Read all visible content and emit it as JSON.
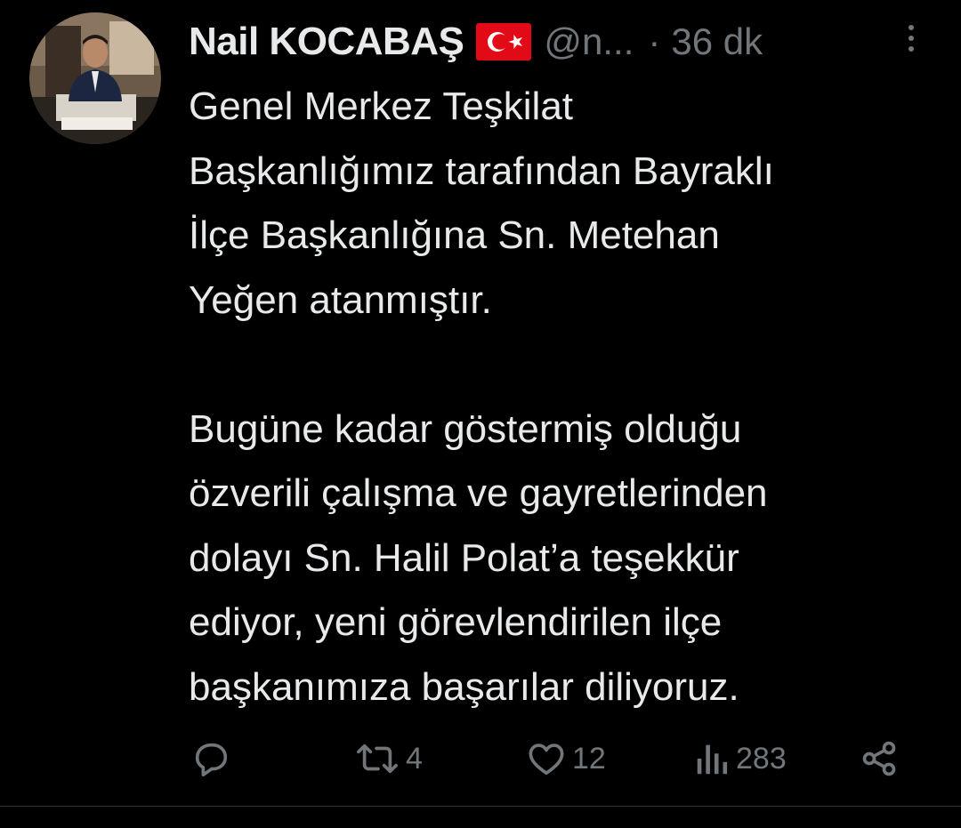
{
  "tweet": {
    "display_name": "Nail KOCABAŞ",
    "handle": "@n...",
    "separator": "·",
    "time": "36 dk",
    "text": "Genel Merkez Teşkilat\nBaşkanlığımız tarafından Bayraklı\nİlçe Başkanlığına Sn. Metehan\nYeğen atanmıştır.\n\nBugüne kadar göstermiş olduğu\nözverili çalışma ve gayretlerinden\ndolayı Sn. Halil Polat’a teşekkür\nediyor, yeni görevlendirilen ilçe\nbaşkanımıza başarılar diliyoruz."
  },
  "actions": {
    "reply": {
      "icon": "reply-icon",
      "count": ""
    },
    "retweet": {
      "icon": "retweet-icon",
      "count": "4"
    },
    "like": {
      "icon": "heart-icon",
      "count": "12"
    },
    "views": {
      "icon": "views-icon",
      "count": "283"
    },
    "share": {
      "icon": "share-icon",
      "count": ""
    }
  },
  "colors": {
    "background": "#000000",
    "primary_text": "#e7e9ea",
    "secondary_text": "#71767b",
    "flag_red": "#e30a17"
  }
}
